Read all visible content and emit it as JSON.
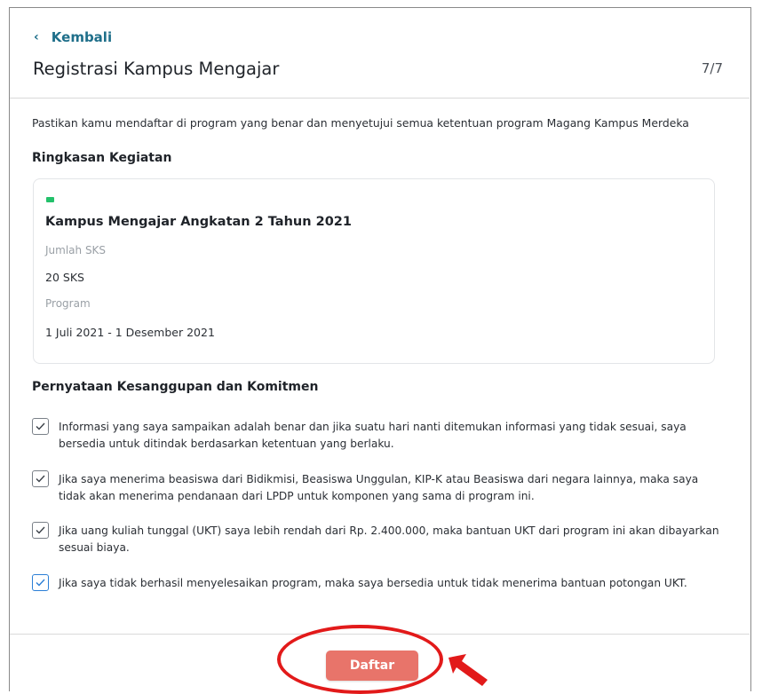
{
  "header": {
    "back_label": "Kembali",
    "back_icon": "chevron-left-icon",
    "title": "Registrasi Kampus Mengajar",
    "step": "7/7"
  },
  "intro": "Pastikan kamu mendaftar di program yang benar dan menyetujui semua ketentuan program Magang Kampus Merdeka",
  "summary": {
    "heading": "Ringkasan Kegiatan",
    "program_title": "Kampus Mengajar Angkatan 2 Tahun 2021",
    "sks_label": "Jumlah SKS",
    "sks_value": "20 SKS",
    "program_label": "Program",
    "program_value": "1 Juli 2021 - 1 Desember 2021",
    "flag_color": "#23c16b"
  },
  "commitment": {
    "heading": "Pernyataan Kesanggupan dan Komitmen",
    "items": [
      {
        "text": "Informasi yang saya sampaikan adalah benar dan jika suatu hari nanti ditemukan informasi yang tidak sesuai, saya bersedia untuk ditindak berdasarkan ketentuan yang berlaku.",
        "checked": true
      },
      {
        "text": "Jika saya menerima beasiswa dari Bidikmisi, Beasiswa Unggulan, KIP-K atau Beasiswa dari negara lainnya, maka saya tidak akan menerima pendanaan dari LPDP untuk komponen yang sama di program ini.",
        "checked": true
      },
      {
        "text": "Jika uang kuliah tunggal (UKT) saya lebih rendah dari Rp. 2.400.000, maka bantuan UKT dari program ini akan dibayarkan sesuai biaya.",
        "checked": true
      },
      {
        "text": "Jika saya tidak berhasil menyelesaikan program, maka saya bersedia untuk tidak menerima bantuan potongan UKT.",
        "checked": true
      }
    ]
  },
  "footer": {
    "submit_label": "Daftar",
    "submit_color": "#e8746a",
    "annotation_color": "#e21a1a"
  }
}
